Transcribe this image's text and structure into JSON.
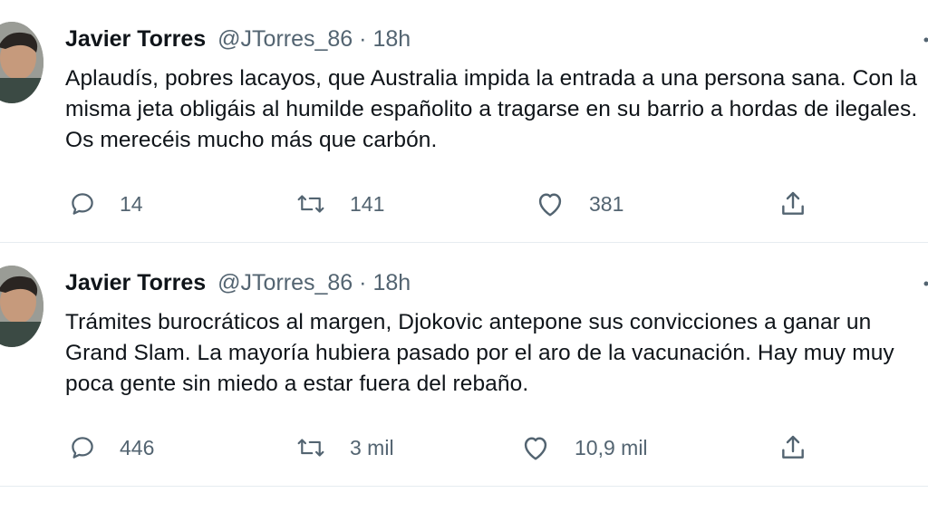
{
  "tweets": [
    {
      "author_name": "Javier Torres",
      "handle": "@JTorres_86",
      "separator": "·",
      "time": "18h",
      "text": "Aplaudís, pobres lacayos, que Australia impida la entrada a una persona sana. Con la misma jeta obligáis al humilde españolito a tragarse en su barrio a hordas de ilegales. Os merecéis mucho más que carbón.",
      "replies": "14",
      "retweets": "141",
      "likes": "381"
    },
    {
      "author_name": "Javier Torres",
      "handle": "@JTorres_86",
      "separator": "·",
      "time": "18h",
      "text": "Trámites burocráticos al margen, Djokovic antepone sus convicciones a ganar un Grand Slam. La mayoría hubiera pasado por el aro de la vacunación. Hay muy muy poca gente sin miedo a estar fuera del rebaño.",
      "replies": "446",
      "retweets": "3 mil",
      "likes": "10,9 mil"
    }
  ],
  "icons": {
    "reply": "reply-icon",
    "retweet": "retweet-icon",
    "like": "like-icon",
    "share": "share-icon",
    "more": "more-icon"
  },
  "colors": {
    "text": "#0f1419",
    "secondary": "#536471",
    "divider": "#e6ecf0"
  }
}
